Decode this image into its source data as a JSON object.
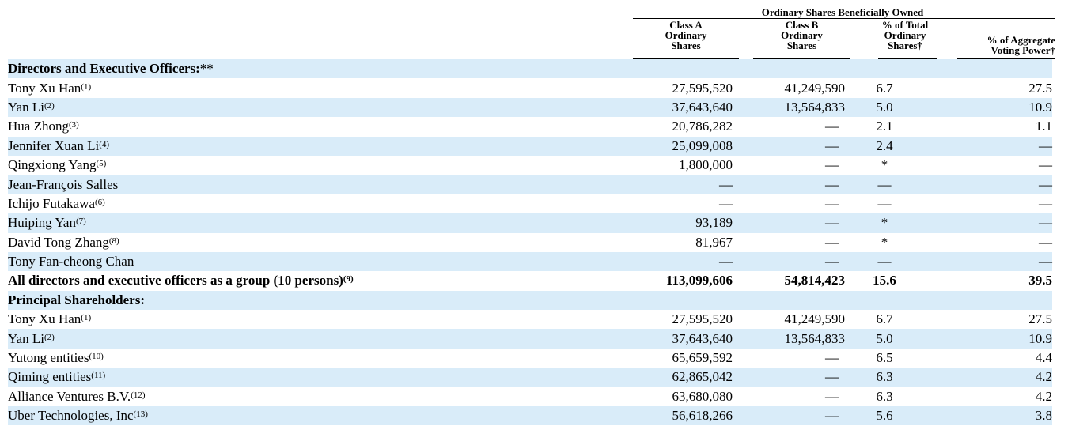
{
  "header": {
    "super_title": "Ordinary Shares Beneficially Owned",
    "col_class_a": [
      "Class A",
      "Ordinary",
      "Shares"
    ],
    "col_class_b": [
      "Class B",
      "Ordinary",
      "Shares"
    ],
    "col_pct_total": [
      "% of Total",
      "Ordinary",
      "Shares†"
    ],
    "col_pct_voting": [
      "% of Aggregate",
      "Voting Power†"
    ]
  },
  "rows": [
    {
      "type": "section",
      "name": "Directors and Executive Officers:**",
      "sup": "",
      "a": "",
      "b": "",
      "pct": "",
      "vote": ""
    },
    {
      "type": "row",
      "name": "Tony Xu Han",
      "sup": "(1)",
      "a": "27,595,520",
      "b": "41,249,590",
      "pct": "6.7",
      "vote": "27.5"
    },
    {
      "type": "row",
      "name": "Yan Li",
      "sup": "(2)",
      "a": "37,643,640",
      "b": "13,564,833",
      "pct": "5.0",
      "vote": "10.9"
    },
    {
      "type": "row",
      "name": "Hua Zhong",
      "sup": "(3)",
      "a": "20,786,282",
      "b": "—",
      "pct": "2.1",
      "vote": "1.1"
    },
    {
      "type": "row",
      "name": "Jennifer Xuan Li",
      "sup": "(4)",
      "a": "25,099,008",
      "b": "—",
      "pct": "2.4",
      "vote": "—"
    },
    {
      "type": "row",
      "name": "Qingxiong Yang",
      "sup": "(5)",
      "a": "1,800,000",
      "b": "—",
      "pct": "*",
      "vote": "—"
    },
    {
      "type": "row",
      "name": "Jean-François Salles",
      "sup": "",
      "a": "—",
      "b": "—",
      "pct": "—",
      "vote": "—"
    },
    {
      "type": "row",
      "name": "Ichijo Futakawa",
      "sup": "(6)",
      "a": "—",
      "b": "—",
      "pct": "—",
      "vote": "—"
    },
    {
      "type": "row",
      "name": "Huiping Yan",
      "sup": "(7)",
      "a": "93,189",
      "b": "—",
      "pct": "*",
      "vote": "—"
    },
    {
      "type": "row",
      "name": "David Tong Zhang",
      "sup": "(8)",
      "a": "81,967",
      "b": "—",
      "pct": "*",
      "vote": "—"
    },
    {
      "type": "row",
      "name": "Tony Fan-cheong Chan",
      "sup": "",
      "a": "—",
      "b": "—",
      "pct": "—",
      "vote": "—"
    },
    {
      "type": "bold",
      "name": "All directors and executive officers as a group (10 persons)",
      "sup": "(9)",
      "a": "113,099,606",
      "b": "54,814,423",
      "pct": "15.6",
      "vote": "39.5"
    },
    {
      "type": "section",
      "name": "Principal Shareholders:",
      "sup": "",
      "a": "",
      "b": "",
      "pct": "",
      "vote": ""
    },
    {
      "type": "row",
      "name": "Tony Xu Han",
      "sup": "(1)",
      "a": "27,595,520",
      "b": "41,249,590",
      "pct": "6.7",
      "vote": "27.5"
    },
    {
      "type": "row",
      "name": "Yan Li",
      "sup": "(2)",
      "a": "37,643,640",
      "b": "13,564,833",
      "pct": "5.0",
      "vote": "10.9"
    },
    {
      "type": "row",
      "name": "Yutong entities",
      "sup": "(10)",
      "a": "65,659,592",
      "b": "—",
      "pct": "6.5",
      "vote": "4.4"
    },
    {
      "type": "row",
      "name": "Qiming entities",
      "sup": "(11)",
      "a": "62,865,042",
      "b": "—",
      "pct": "6.3",
      "vote": "4.2"
    },
    {
      "type": "row",
      "name": "Alliance Ventures B.V.",
      "sup": "(12)",
      "a": "63,680,080",
      "b": "—",
      "pct": "6.3",
      "vote": "4.2"
    },
    {
      "type": "row",
      "name": "Uber Technologies, Inc",
      "sup": "(13)",
      "a": "56,618,266",
      "b": "—",
      "pct": "5.6",
      "vote": "3.8"
    }
  ]
}
